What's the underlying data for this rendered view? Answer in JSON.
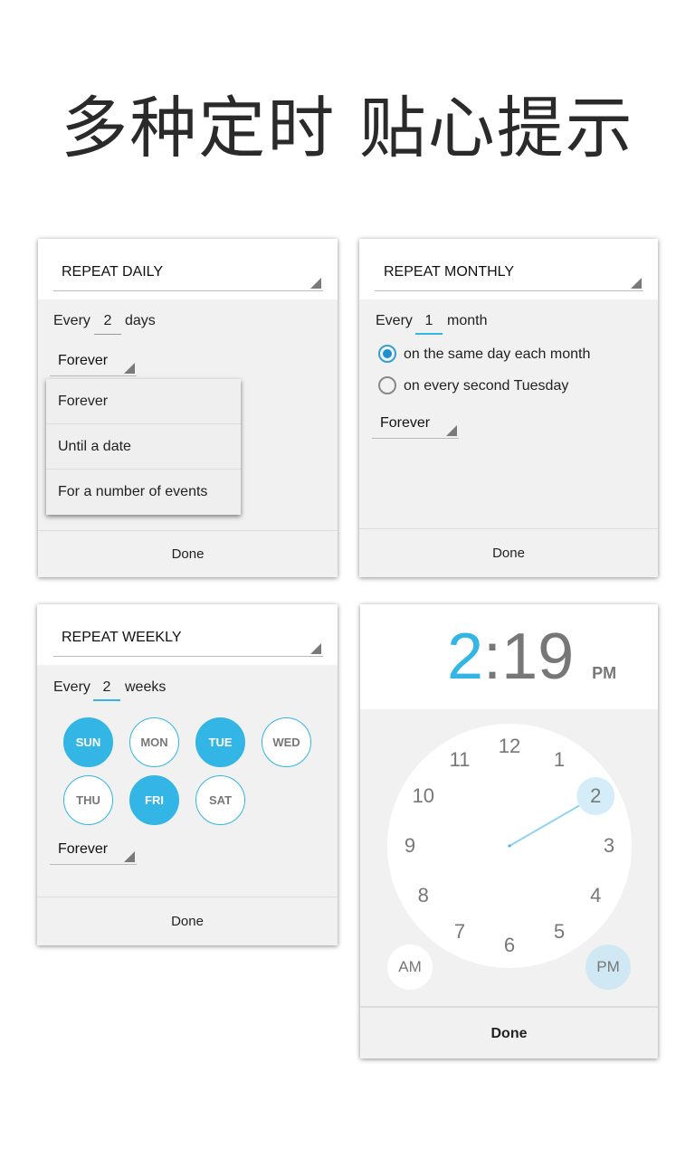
{
  "headline": "多种定时 贴心提示",
  "daily": {
    "repeat": "REPEAT DAILY",
    "every": "Every",
    "value": "2",
    "unit": "days",
    "end": "Forever",
    "menu": [
      "Forever",
      "Until a date",
      "For a number of events"
    ],
    "done": "Done"
  },
  "monthly": {
    "repeat": "REPEAT MONTHLY",
    "every": "Every",
    "value": "1",
    "unit": "month",
    "options": [
      {
        "label": "on the same day each month",
        "selected": true
      },
      {
        "label": "on every second Tuesday",
        "selected": false
      }
    ],
    "end": "Forever",
    "done": "Done"
  },
  "weekly": {
    "repeat": "REPEAT WEEKLY",
    "every": "Every",
    "value": "2",
    "unit": "weeks",
    "days": [
      {
        "label": "SUN",
        "selected": true
      },
      {
        "label": "MON",
        "selected": false
      },
      {
        "label": "TUE",
        "selected": true
      },
      {
        "label": "WED",
        "selected": false
      },
      {
        "label": "THU",
        "selected": false
      },
      {
        "label": "FRI",
        "selected": true
      },
      {
        "label": "SAT",
        "selected": false
      }
    ],
    "end": "Forever",
    "done": "Done"
  },
  "time": {
    "hour": "2",
    "sep": ":",
    "minute": "19",
    "ampm": "PM",
    "numbers": [
      "12",
      "1",
      "2",
      "3",
      "4",
      "5",
      "6",
      "7",
      "8",
      "9",
      "10",
      "11"
    ],
    "selected_hour": 2,
    "am": "AM",
    "pm": "PM",
    "done": "Done",
    "accent": "#33b5e5"
  }
}
